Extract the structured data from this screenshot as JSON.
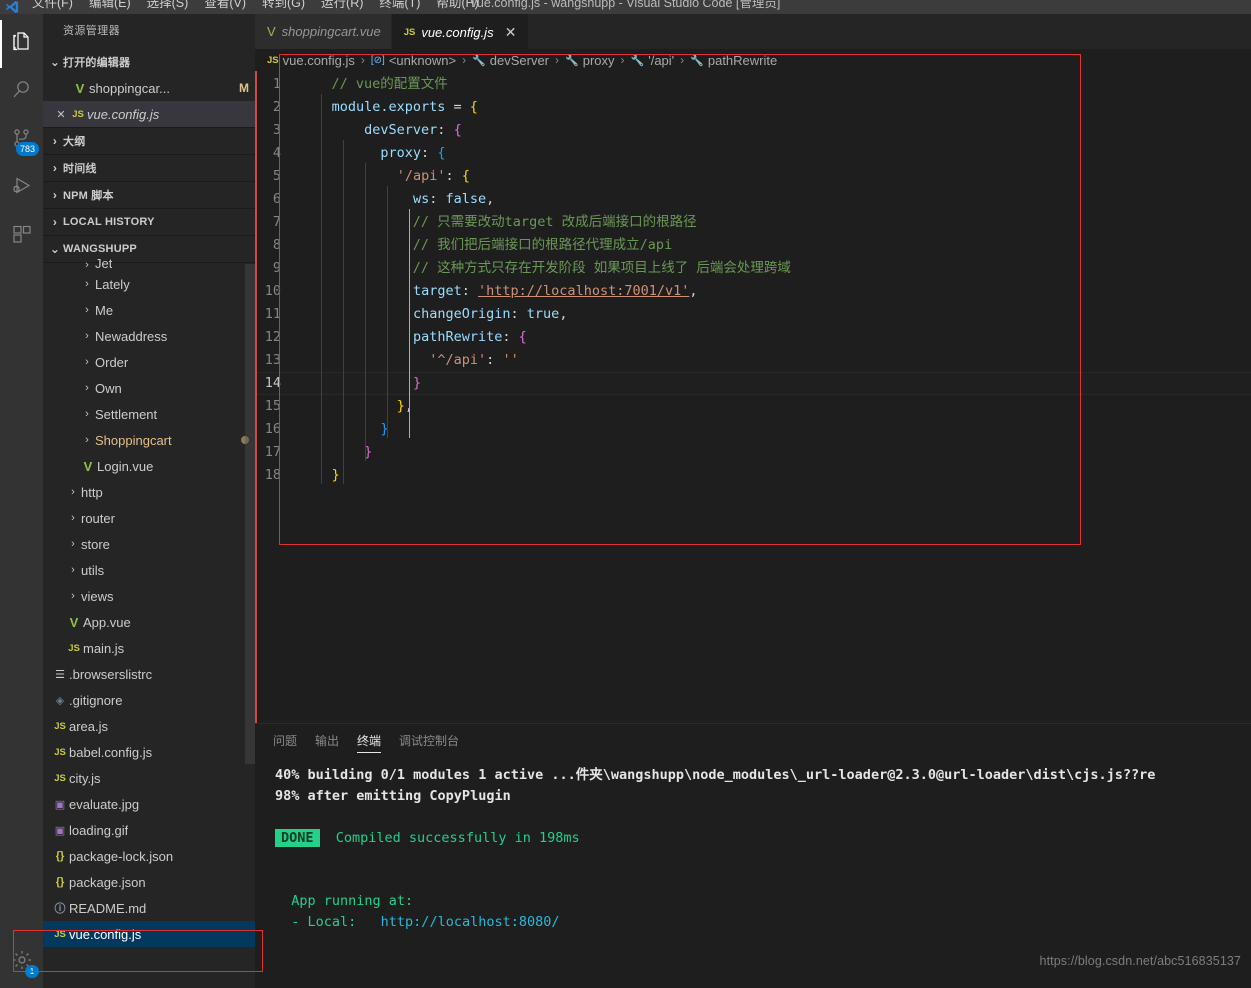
{
  "titlebar": {
    "menus": [
      "文件(F)",
      "编辑(E)",
      "选择(S)",
      "查看(V)",
      "转到(G)",
      "运行(R)",
      "终端(T)",
      "帮助(H)"
    ],
    "window_title": "vue.config.js - wangshupp - Visual Studio Code [管理员]"
  },
  "activitybar": {
    "items": [
      {
        "name": "explorer",
        "icon": "files-icon",
        "badge": ""
      },
      {
        "name": "search",
        "icon": "search-icon",
        "badge": ""
      },
      {
        "name": "source-control",
        "icon": "source-control-icon",
        "badge": "783"
      },
      {
        "name": "run-and-debug",
        "icon": "run-debug-icon",
        "badge": ""
      },
      {
        "name": "extensions",
        "icon": "extensions-icon",
        "badge": ""
      }
    ],
    "bottom": [
      {
        "name": "settings",
        "icon": "gear-icon",
        "badge": "1"
      }
    ]
  },
  "sidebar": {
    "title": "资源管理器",
    "sections": [
      {
        "label": "打开的编辑器",
        "expanded": true
      },
      {
        "label": "大纲",
        "expanded": false
      },
      {
        "label": "时间线",
        "expanded": false
      },
      {
        "label": "NPM 脚本",
        "expanded": false
      },
      {
        "label": "LOCAL HISTORY",
        "expanded": false
      },
      {
        "label": "WANGSHUPP",
        "expanded": true
      }
    ],
    "open_editors": [
      {
        "label": "shoppingcar...",
        "icon": "vue-icon",
        "status": "M",
        "selected": false
      },
      {
        "label": "vue.config.js",
        "icon": "js-icon",
        "status": "",
        "selected": true,
        "close": "✕"
      }
    ],
    "tree": [
      {
        "label": "Jet",
        "icon": "folder",
        "indent": 2,
        "cut_off": true
      },
      {
        "label": "Lately",
        "icon": "folder",
        "indent": 2
      },
      {
        "label": "Me",
        "icon": "folder",
        "indent": 2
      },
      {
        "label": "Newaddress",
        "icon": "folder",
        "indent": 2
      },
      {
        "label": "Order",
        "icon": "folder",
        "indent": 2
      },
      {
        "label": "Own",
        "icon": "folder",
        "indent": 2
      },
      {
        "label": "Settlement",
        "icon": "folder",
        "indent": 2
      },
      {
        "label": "Shoppingcart",
        "icon": "folder",
        "indent": 2,
        "modified": true
      },
      {
        "label": "Login.vue",
        "icon": "vue-icon",
        "indent": 2
      },
      {
        "label": "http",
        "icon": "folder",
        "indent": 1
      },
      {
        "label": "router",
        "icon": "folder",
        "indent": 1
      },
      {
        "label": "store",
        "icon": "folder",
        "indent": 1
      },
      {
        "label": "utils",
        "icon": "folder",
        "indent": 1
      },
      {
        "label": "views",
        "icon": "folder",
        "indent": 1
      },
      {
        "label": "App.vue",
        "icon": "vue-icon",
        "indent": 1
      },
      {
        "label": "main.js",
        "icon": "js-icon",
        "indent": 1
      },
      {
        "label": ".browserslistrc",
        "icon": "text-icon",
        "indent": 0
      },
      {
        "label": ".gitignore",
        "icon": "git-icon",
        "indent": 0
      },
      {
        "label": "area.js",
        "icon": "js-icon",
        "indent": 0
      },
      {
        "label": "babel.config.js",
        "icon": "js-icon",
        "indent": 0
      },
      {
        "label": "city.js",
        "icon": "js-icon",
        "indent": 0
      },
      {
        "label": "evaluate.jpg",
        "icon": "image-icon",
        "indent": 0
      },
      {
        "label": "loading.gif",
        "icon": "image-icon",
        "indent": 0
      },
      {
        "label": "package-lock.json",
        "icon": "json-icon",
        "indent": 0
      },
      {
        "label": "package.json",
        "icon": "json-icon",
        "indent": 0
      },
      {
        "label": "README.md",
        "icon": "markdown-icon",
        "indent": 0
      },
      {
        "label": "vue.config.js",
        "icon": "js-icon",
        "indent": 0,
        "highlighted": true
      }
    ]
  },
  "editor": {
    "tabs": [
      {
        "label": "shoppingcart.vue",
        "icon": "vue-icon",
        "active": false
      },
      {
        "label": "vue.config.js",
        "icon": "js-icon",
        "active": true,
        "close": "✕"
      }
    ],
    "breadcrumb": [
      {
        "text": "vue.config.js",
        "icon": "js-icon"
      },
      {
        "text": "<unknown>",
        "icon": "module-icon"
      },
      {
        "text": "devServer",
        "icon": "property-icon"
      },
      {
        "text": "proxy",
        "icon": "property-icon"
      },
      {
        "text": "'/api'",
        "icon": "property-icon"
      },
      {
        "text": "pathRewrite",
        "icon": "property-icon"
      }
    ],
    "lines": [
      {
        "n": "1",
        "text": "    // vue的配置文件"
      },
      {
        "n": "2",
        "text": "    module.exports = {"
      },
      {
        "n": "3",
        "text": "        devServer: {"
      },
      {
        "n": "4",
        "text": "          proxy: {"
      },
      {
        "n": "5",
        "text": "            '/api': {"
      },
      {
        "n": "6",
        "text": "              ws: false,"
      },
      {
        "n": "7",
        "text": "              // 只需要改动target 改成后端接口的根路径"
      },
      {
        "n": "8",
        "text": "              // 我们把后端接口的根路径代理成立/api"
      },
      {
        "n": "9",
        "text": "              // 这种方式只存在开发阶段 如果项目上线了 后端会处理跨域"
      },
      {
        "n": "10",
        "text": "              target: 'http://localhost:7001/v1',"
      },
      {
        "n": "11",
        "text": "              changeOrigin: true,"
      },
      {
        "n": "12",
        "text": "              pathRewrite: {"
      },
      {
        "n": "13",
        "text": "                '^/api': ''"
      },
      {
        "n": "14",
        "text": "              }"
      },
      {
        "n": "15",
        "text": "            },"
      },
      {
        "n": "16",
        "text": "          }"
      },
      {
        "n": "17",
        "text": "        }"
      },
      {
        "n": "18",
        "text": "    }"
      }
    ]
  },
  "panel": {
    "tabs": [
      "问题",
      "输出",
      "终端",
      "调试控制台"
    ],
    "active_tab": "终端",
    "terminal_lines": [
      {
        "kind": "white",
        "text": "40% building 0/1 modules 1 active ...件夹\\wangshupp\\node_modules\\_url-loader@2.3.0@url-loader\\dist\\cjs.js??re"
      },
      {
        "kind": "white",
        "text": "98% after emitting CopyPlugin"
      },
      {
        "kind": "blank",
        "text": ""
      },
      {
        "kind": "done",
        "badge": "DONE",
        "text": "Compiled successfully in 198ms"
      },
      {
        "kind": "blank",
        "text": ""
      },
      {
        "kind": "blank",
        "text": ""
      },
      {
        "kind": "green",
        "text": "  App running at:"
      },
      {
        "kind": "local",
        "prefix": "  - Local:   ",
        "link": "http://localhost:8080/"
      }
    ]
  },
  "watermark": "https://blog.csdn.net/abc516835137",
  "colors": {
    "accent": "#007acc",
    "annotation": "#e03030",
    "selection": "#04395e",
    "terminal_green": "#23d18b"
  }
}
